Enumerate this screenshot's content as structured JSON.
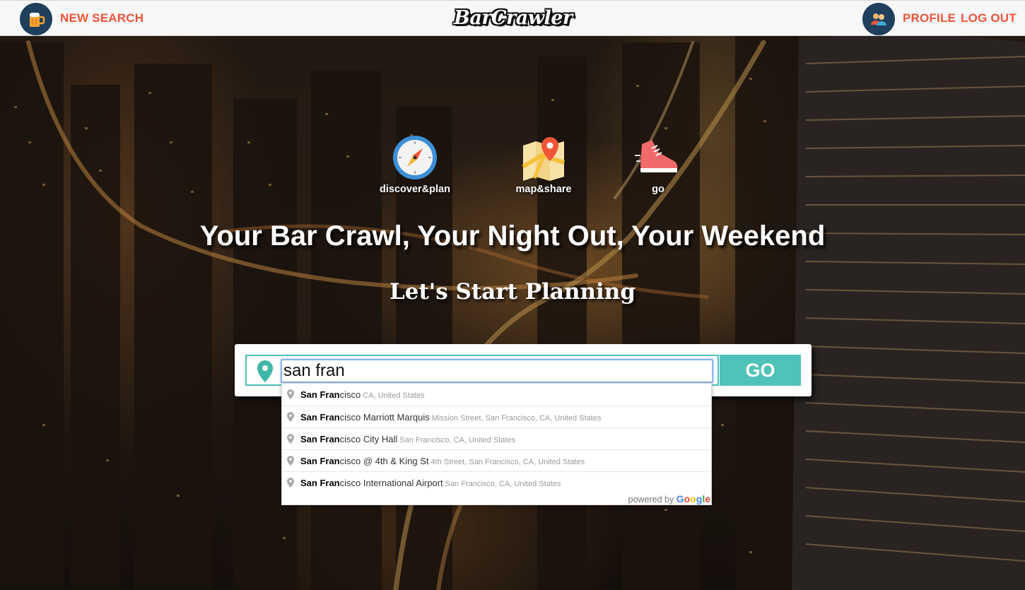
{
  "nav": {
    "new_search_label": "NEW SEARCH",
    "logo_text": "BarCrawler",
    "profile_label": "PROFILE",
    "logout_label": "LOG OUT"
  },
  "features": [
    {
      "label": "discover&plan",
      "icon": "compass-icon"
    },
    {
      "label": "map&share",
      "icon": "map-pin-icon"
    },
    {
      "label": "go",
      "icon": "sneaker-icon"
    }
  ],
  "hero": {
    "headline": "Your Bar Crawl, Your Night Out, Your Weekend",
    "subhead": "Let's Start Planning"
  },
  "search": {
    "value": "san fran",
    "go_label": "GO"
  },
  "suggestions": [
    {
      "match": "San Fran",
      "rest": "cisco",
      "secondary": "CA, United States"
    },
    {
      "match": "San Fran",
      "rest": "cisco Marriott Marquis",
      "secondary": "Mission Street, San Francisco, CA, United States"
    },
    {
      "match": "San Fran",
      "rest": "cisco City Hall",
      "secondary": "San Francisco, CA, United States"
    },
    {
      "match": "San Fran",
      "rest": "cisco @ 4th & King St",
      "secondary": "4th Street, San Francisco, CA, United States"
    },
    {
      "match": "San Fran",
      "rest": "cisco International Airport",
      "secondary": "San Francisco, CA, United States"
    }
  ],
  "powered_by": {
    "prefix": "powered by",
    "brand": "Google"
  },
  "colors": {
    "accent_orange": "#f0553a",
    "teal": "#4fc2b9",
    "navy": "#1f3f5c"
  }
}
